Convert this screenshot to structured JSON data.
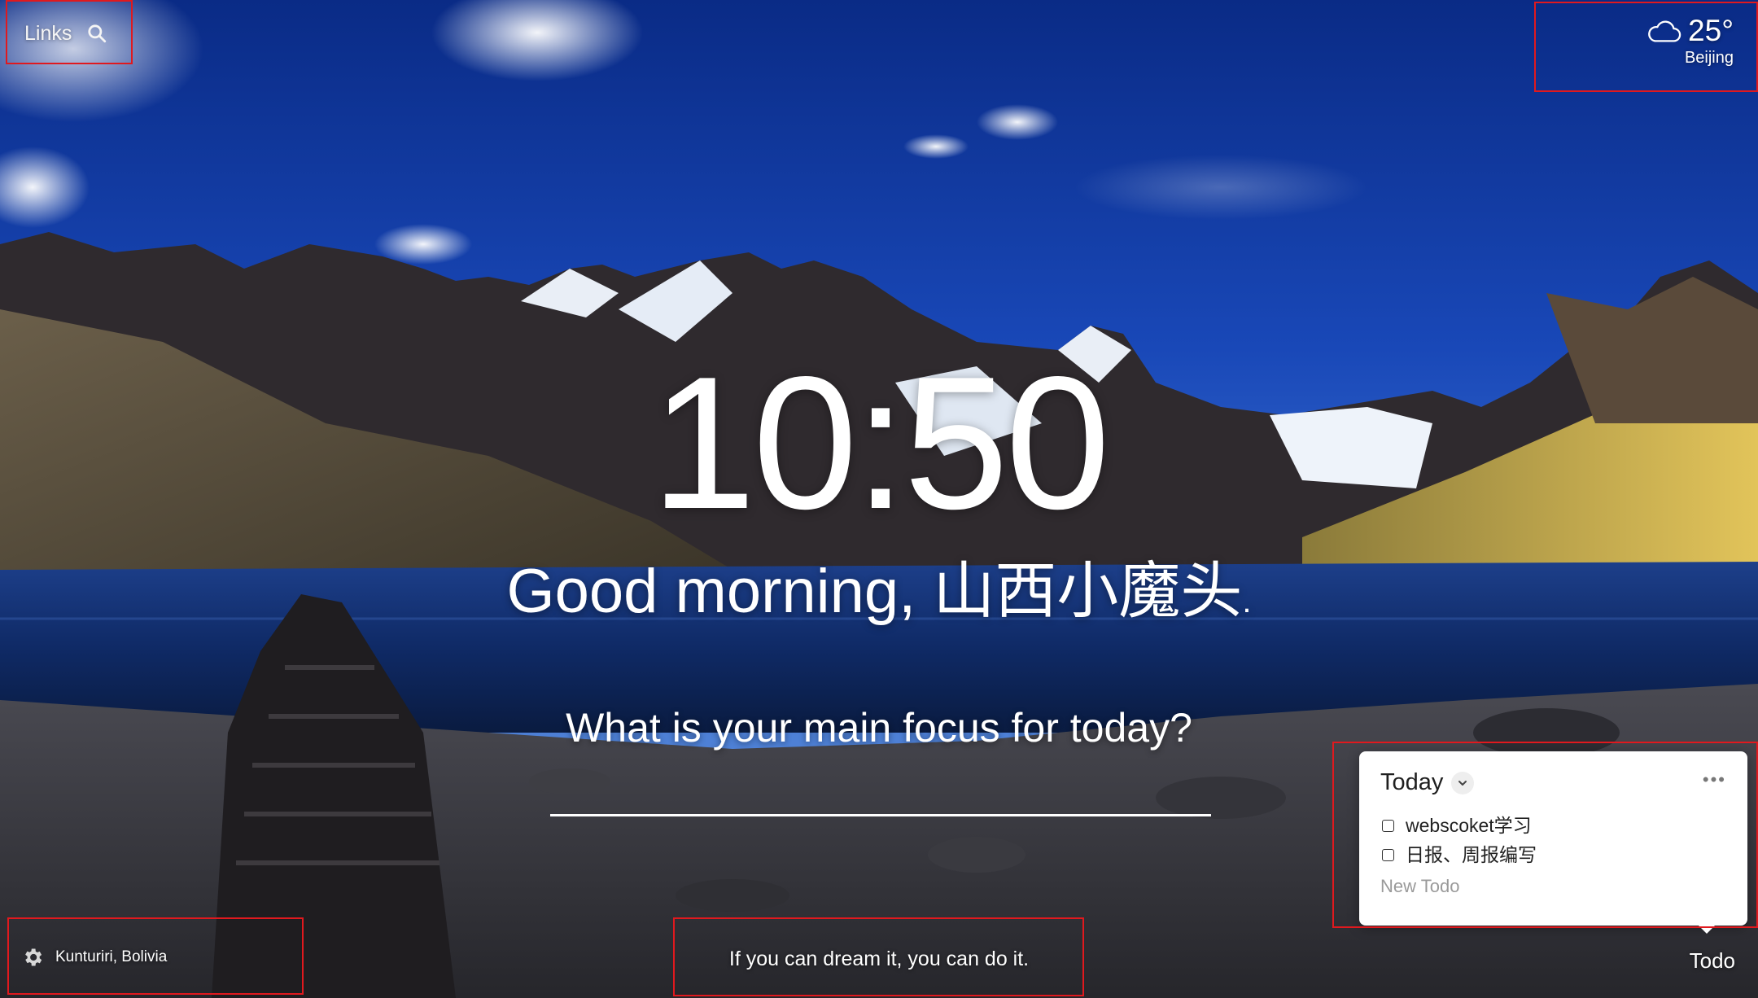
{
  "top_left": {
    "links_label": "Links",
    "search_icon": "search-icon"
  },
  "weather": {
    "icon": "cloud-icon",
    "temperature": "25°",
    "location": "Beijing"
  },
  "clock": {
    "time": "10:50"
  },
  "greeting": {
    "text": "Good morning, ",
    "name": "山西小魔头",
    "suffix": "."
  },
  "focus": {
    "question": "What is your main focus for today?",
    "input_value": ""
  },
  "background_location": {
    "icon": "gear-icon",
    "label": "Kunturiri, Bolivia"
  },
  "quote": {
    "text": "If you can dream it, you can do it."
  },
  "todo": {
    "toggle_label": "Todo",
    "list_title": "Today",
    "more_icon": "more-icon",
    "items": [
      {
        "label": "webscoket学习",
        "done": false
      },
      {
        "label": "日报、周报编写",
        "done": false
      }
    ],
    "new_placeholder": "New Todo"
  },
  "colors": {
    "annotation_red": "#e0191e",
    "sky_blue": "#1a3f9a",
    "panel_bg": "#ffffff"
  }
}
